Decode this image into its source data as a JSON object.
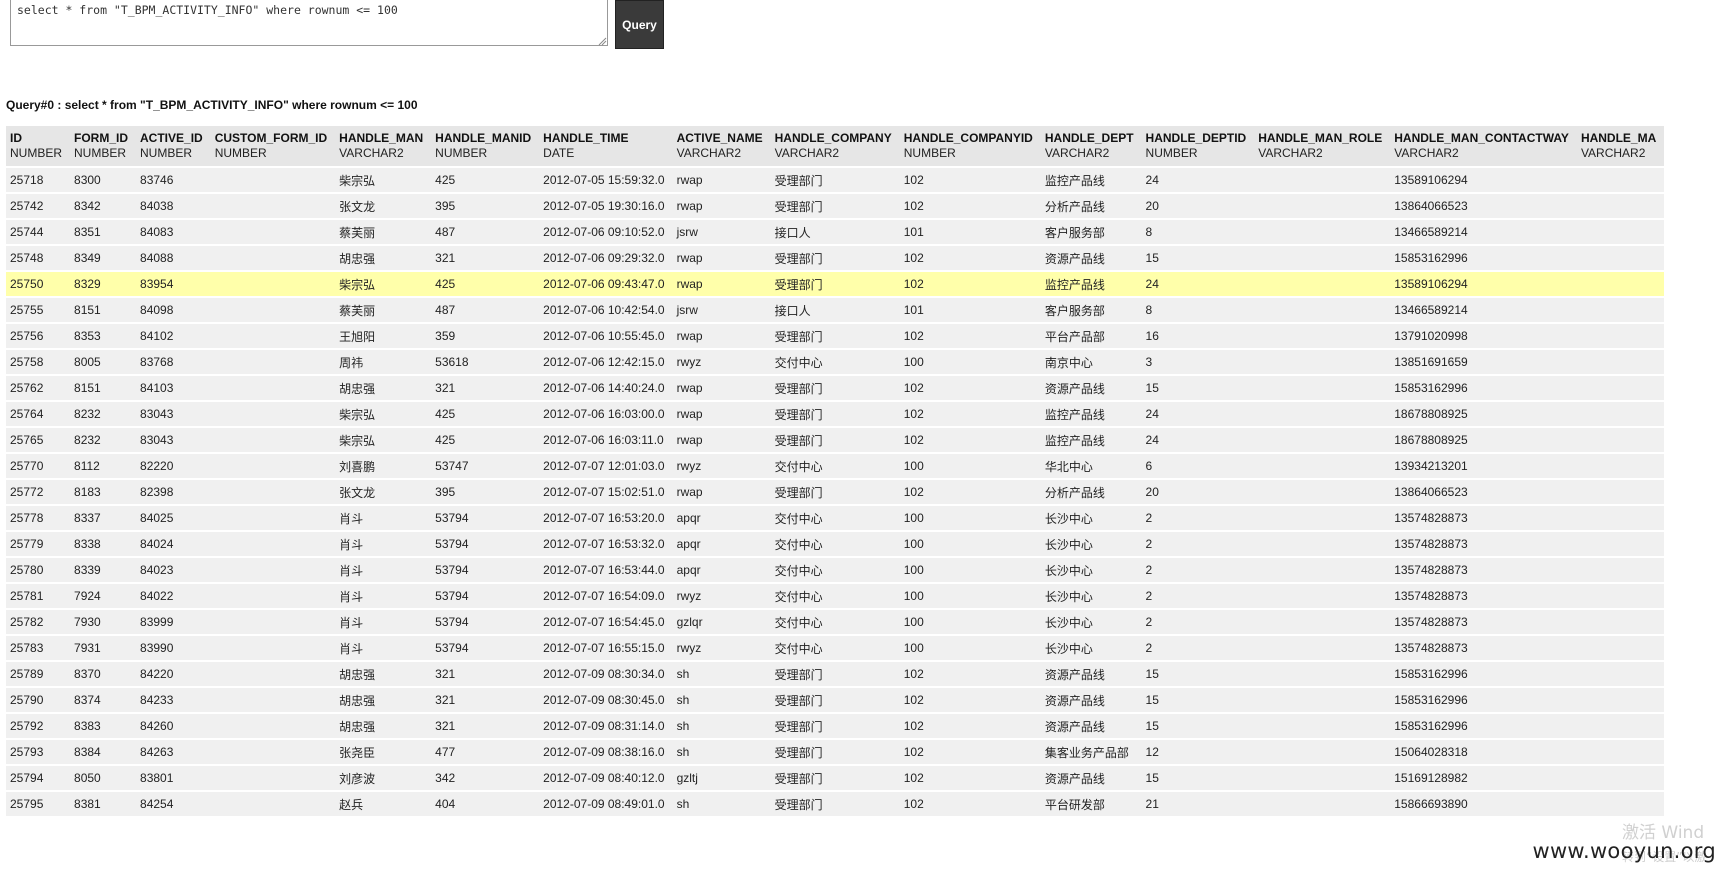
{
  "editor": {
    "sql": "select * from \"T_BPM_ACTIVITY_INFO\" where rownum <= 100",
    "button_label": "Query"
  },
  "result": {
    "title": "Query#0 : select * from \"T_BPM_ACTIVITY_INFO\" where rownum <= 100",
    "columns": [
      {
        "name": "ID",
        "type": "NUMBER"
      },
      {
        "name": "FORM_ID",
        "type": "NUMBER"
      },
      {
        "name": "ACTIVE_ID",
        "type": "NUMBER"
      },
      {
        "name": "CUSTOM_FORM_ID",
        "type": "NUMBER"
      },
      {
        "name": "HANDLE_MAN",
        "type": "VARCHAR2"
      },
      {
        "name": "HANDLE_MANID",
        "type": "NUMBER"
      },
      {
        "name": "HANDLE_TIME",
        "type": "DATE"
      },
      {
        "name": "ACTIVE_NAME",
        "type": "VARCHAR2"
      },
      {
        "name": "HANDLE_COMPANY",
        "type": "VARCHAR2"
      },
      {
        "name": "HANDLE_COMPANYID",
        "type": "NUMBER"
      },
      {
        "name": "HANDLE_DEPT",
        "type": "VARCHAR2"
      },
      {
        "name": "HANDLE_DEPTID",
        "type": "NUMBER"
      },
      {
        "name": "HANDLE_MAN_ROLE",
        "type": "VARCHAR2"
      },
      {
        "name": "HANDLE_MAN_CONTACTWAY",
        "type": "VARCHAR2"
      },
      {
        "name": "HANDLE_MA",
        "type": "VARCHAR2"
      }
    ],
    "highlighted_row": 4,
    "rows": [
      [
        "25718",
        "8300",
        "83746",
        "",
        "柴宗弘",
        "425",
        "2012-07-05 15:59:32.0",
        "rwap",
        "受理部门",
        "102",
        "监控产品线",
        "24",
        "",
        "13589106294",
        ""
      ],
      [
        "25742",
        "8342",
        "84038",
        "",
        "张文龙",
        "395",
        "2012-07-05 19:30:16.0",
        "rwap",
        "受理部门",
        "102",
        "分析产品线",
        "20",
        "",
        "13864066523",
        ""
      ],
      [
        "25744",
        "8351",
        "84083",
        "",
        "蔡芙丽",
        "487",
        "2012-07-06 09:10:52.0",
        "jsrw",
        "接口人",
        "101",
        "客户服务部",
        "8",
        "",
        "13466589214",
        ""
      ],
      [
        "25748",
        "8349",
        "84088",
        "",
        "胡忠强",
        "321",
        "2012-07-06 09:29:32.0",
        "rwap",
        "受理部门",
        "102",
        "资源产品线",
        "15",
        "",
        "15853162996",
        ""
      ],
      [
        "25750",
        "8329",
        "83954",
        "",
        "柴宗弘",
        "425",
        "2012-07-06 09:43:47.0",
        "rwap",
        "受理部门",
        "102",
        "监控产品线",
        "24",
        "",
        "13589106294",
        ""
      ],
      [
        "25755",
        "8151",
        "84098",
        "",
        "蔡芙丽",
        "487",
        "2012-07-06 10:42:54.0",
        "jsrw",
        "接口人",
        "101",
        "客户服务部",
        "8",
        "",
        "13466589214",
        ""
      ],
      [
        "25756",
        "8353",
        "84102",
        "",
        "王旭阳",
        "359",
        "2012-07-06 10:55:45.0",
        "rwap",
        "受理部门",
        "102",
        "平台产品部",
        "16",
        "",
        "13791020998",
        ""
      ],
      [
        "25758",
        "8005",
        "83768",
        "",
        "周祎",
        "53618",
        "2012-07-06 12:42:15.0",
        "rwyz",
        "交付中心",
        "100",
        "南京中心",
        "3",
        "",
        "13851691659",
        ""
      ],
      [
        "25762",
        "8151",
        "84103",
        "",
        "胡忠强",
        "321",
        "2012-07-06 14:40:24.0",
        "rwap",
        "受理部门",
        "102",
        "资源产品线",
        "15",
        "",
        "15853162996",
        ""
      ],
      [
        "25764",
        "8232",
        "83043",
        "",
        "柴宗弘",
        "425",
        "2012-07-06 16:03:00.0",
        "rwap",
        "受理部门",
        "102",
        "监控产品线",
        "24",
        "",
        "18678808925",
        ""
      ],
      [
        "25765",
        "8232",
        "83043",
        "",
        "柴宗弘",
        "425",
        "2012-07-06 16:03:11.0",
        "rwap",
        "受理部门",
        "102",
        "监控产品线",
        "24",
        "",
        "18678808925",
        ""
      ],
      [
        "25770",
        "8112",
        "82220",
        "",
        "刘喜鹏",
        "53747",
        "2012-07-07 12:01:03.0",
        "rwyz",
        "交付中心",
        "100",
        "华北中心",
        "6",
        "",
        "13934213201",
        ""
      ],
      [
        "25772",
        "8183",
        "82398",
        "",
        "张文龙",
        "395",
        "2012-07-07 15:02:51.0",
        "rwap",
        "受理部门",
        "102",
        "分析产品线",
        "20",
        "",
        "13864066523",
        ""
      ],
      [
        "25778",
        "8337",
        "84025",
        "",
        "肖斗",
        "53794",
        "2012-07-07 16:53:20.0",
        "apqr",
        "交付中心",
        "100",
        "长沙中心",
        "2",
        "",
        "13574828873",
        ""
      ],
      [
        "25779",
        "8338",
        "84024",
        "",
        "肖斗",
        "53794",
        "2012-07-07 16:53:32.0",
        "apqr",
        "交付中心",
        "100",
        "长沙中心",
        "2",
        "",
        "13574828873",
        ""
      ],
      [
        "25780",
        "8339",
        "84023",
        "",
        "肖斗",
        "53794",
        "2012-07-07 16:53:44.0",
        "apqr",
        "交付中心",
        "100",
        "长沙中心",
        "2",
        "",
        "13574828873",
        ""
      ],
      [
        "25781",
        "7924",
        "84022",
        "",
        "肖斗",
        "53794",
        "2012-07-07 16:54:09.0",
        "rwyz",
        "交付中心",
        "100",
        "长沙中心",
        "2",
        "",
        "13574828873",
        ""
      ],
      [
        "25782",
        "7930",
        "83999",
        "",
        "肖斗",
        "53794",
        "2012-07-07 16:54:45.0",
        "gzlqr",
        "交付中心",
        "100",
        "长沙中心",
        "2",
        "",
        "13574828873",
        ""
      ],
      [
        "25783",
        "7931",
        "83990",
        "",
        "肖斗",
        "53794",
        "2012-07-07 16:55:15.0",
        "rwyz",
        "交付中心",
        "100",
        "长沙中心",
        "2",
        "",
        "13574828873",
        ""
      ],
      [
        "25789",
        "8370",
        "84220",
        "",
        "胡忠强",
        "321",
        "2012-07-09 08:30:34.0",
        "sh",
        "受理部门",
        "102",
        "资源产品线",
        "15",
        "",
        "15853162996",
        ""
      ],
      [
        "25790",
        "8374",
        "84233",
        "",
        "胡忠强",
        "321",
        "2012-07-09 08:30:45.0",
        "sh",
        "受理部门",
        "102",
        "资源产品线",
        "15",
        "",
        "15853162996",
        ""
      ],
      [
        "25792",
        "8383",
        "84260",
        "",
        "胡忠强",
        "321",
        "2012-07-09 08:31:14.0",
        "sh",
        "受理部门",
        "102",
        "资源产品线",
        "15",
        "",
        "15853162996",
        ""
      ],
      [
        "25793",
        "8384",
        "84263",
        "",
        "张尧臣",
        "477",
        "2012-07-09 08:38:16.0",
        "sh",
        "受理部门",
        "102",
        "集客业务产品部",
        "12",
        "",
        "15064028318",
        ""
      ],
      [
        "25794",
        "8050",
        "83801",
        "",
        "刘彦波",
        "342",
        "2012-07-09 08:40:12.0",
        "gzltj",
        "受理部门",
        "102",
        "资源产品线",
        "15",
        "",
        "15169128982",
        ""
      ],
      [
        "25795",
        "8381",
        "84254",
        "",
        "赵兵",
        "404",
        "2012-07-09 08:49:01.0",
        "sh",
        "受理部门",
        "102",
        "平台研发部",
        "21",
        "",
        "15866693890",
        ""
      ]
    ]
  },
  "overlay": {
    "watermark": "www.wooyun.org",
    "activation_line1": "激活 Wind",
    "activation_line2": "转到“设置”以激"
  }
}
